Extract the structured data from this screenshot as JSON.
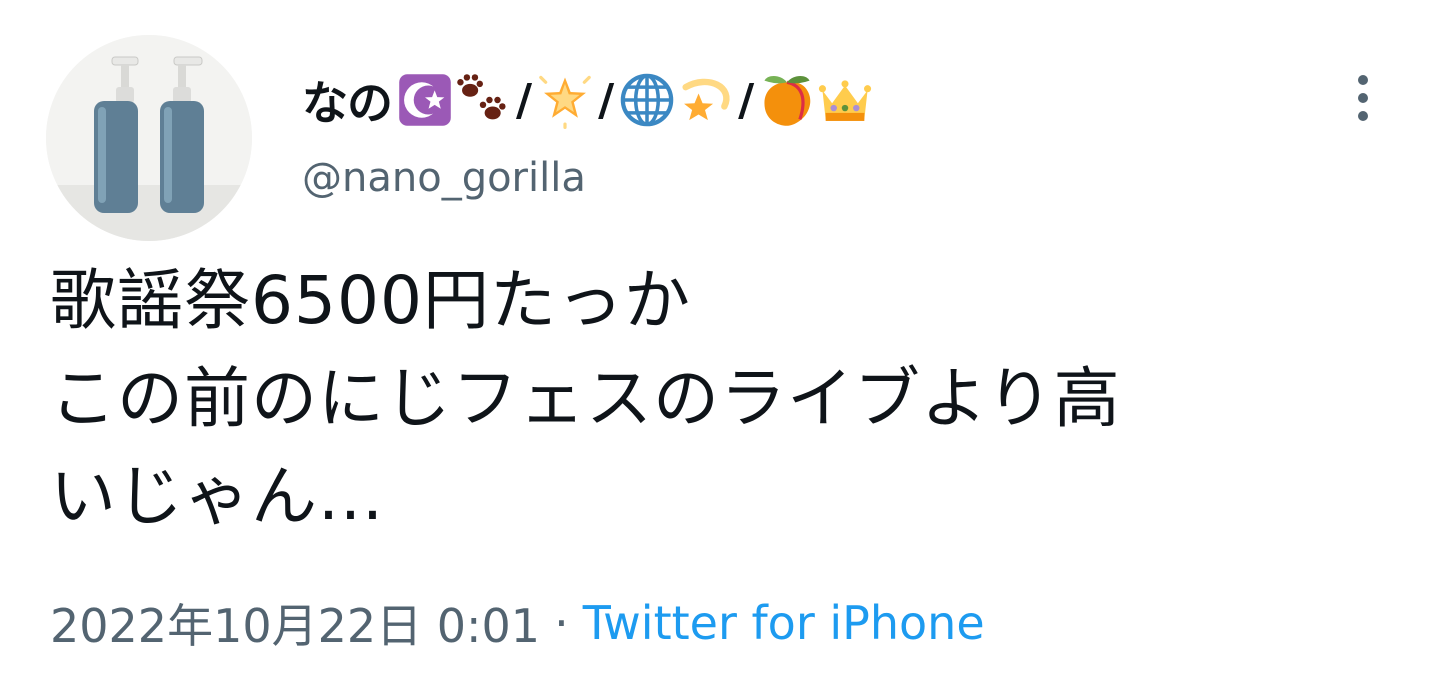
{
  "tweet": {
    "author": {
      "display_name": "なの",
      "slash": "/",
      "handle": "@nano_gorilla",
      "name_emojis": [
        "crescent-star-icon",
        "paw-prints-icon",
        "glowing-star-icon",
        "globe-icon",
        "dizzy-star-icon",
        "peach-icon",
        "crown-icon"
      ]
    },
    "text_lines": [
      "歌謡祭6500円たっか",
      "この前のにじフェスのライブより高",
      "いじゃん..."
    ],
    "timestamp": "2022年10月22日 0:01",
    "separator": "·",
    "source": "Twitter for iPhone"
  },
  "colors": {
    "text": "#0f1419",
    "secondary": "#536471",
    "link": "#1d9bf0"
  }
}
